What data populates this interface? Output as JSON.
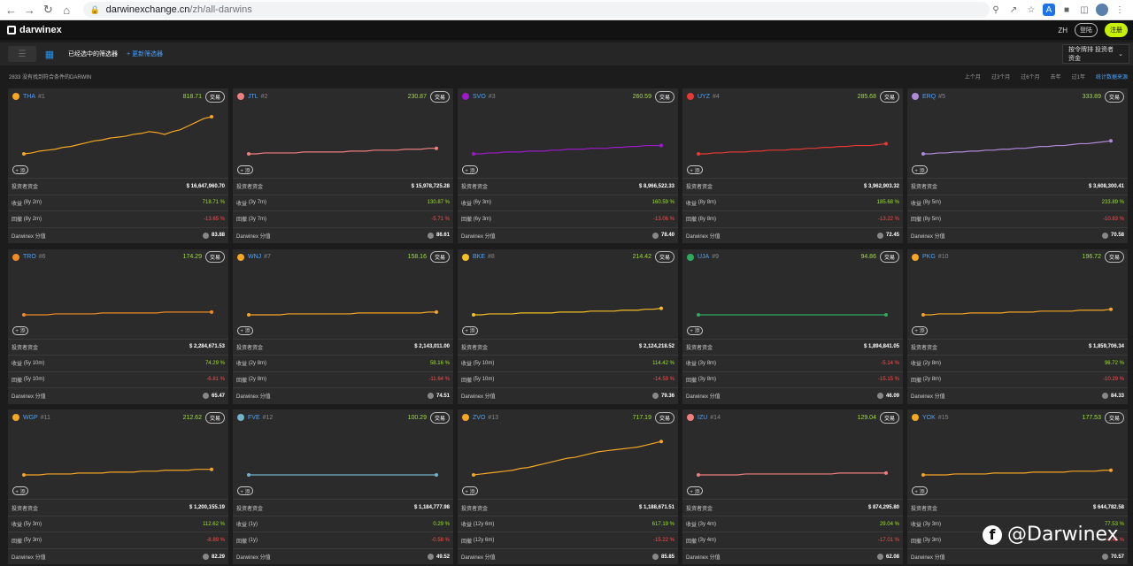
{
  "browser": {
    "url_host": "darwinexchange.cn",
    "url_path": "/zh/all-darwins",
    "icons": [
      "back-icon",
      "forward-icon",
      "reload-icon",
      "home-icon",
      "lock-icon",
      "zoom-icon",
      "share-icon",
      "star-icon",
      "translate-icon",
      "extensions-icon",
      "sidebar-icon",
      "profile-icon",
      "menu-icon"
    ]
  },
  "topbar": {
    "logo_text": "darwinex",
    "lang": "ZH",
    "login_label": "登陆",
    "register_label": "注册"
  },
  "toolbar": {
    "title": "已经选中的筛选器",
    "add_filter": "+ 更新筛选器",
    "sort_label": "按令牌排 投资者资金"
  },
  "subbar": {
    "results": "2833 没有找到符合条件的DARWIN",
    "periods": [
      "上个月",
      "过3个月",
      "过6个月",
      "去年",
      "过1年",
      "统计数据来源"
    ],
    "active_index": 5
  },
  "labels": {
    "investor_funds": "投资者资金",
    "return": "收益",
    "drawdown": "回撤",
    "score": "Darwinex 分值",
    "trade": "交易",
    "add": "+ 添"
  },
  "cards": [
    {
      "ticker": "THA",
      "rank": "#1",
      "price": "818.71",
      "color": "#f5a623",
      "funds": "$ 16,647,960.70",
      "ret_period": "(8y 2m)",
      "ret": "718.71 %",
      "dd_period": "(8y 2m)",
      "dd": "-13.65 %",
      "score": "83.88",
      "curve": [
        10,
        11,
        13,
        14,
        15,
        17,
        18,
        20,
        22,
        24,
        25,
        27,
        28,
        29,
        31,
        32,
        34,
        33,
        31,
        34,
        36,
        40,
        44,
        48,
        50
      ]
    },
    {
      "ticker": "JTL",
      "rank": "#2",
      "price": "230.87",
      "color": "#ef7f7f",
      "funds": "$ 15,978,725.28",
      "ret_period": "(3y 7m)",
      "ret": "130.87 %",
      "dd_period": "(3y 7m)",
      "dd": "-5.71 %",
      "score": "86.61",
      "curve": [
        10,
        10,
        11,
        11,
        11,
        11,
        11,
        12,
        12,
        12,
        12,
        12,
        12,
        13,
        13,
        13,
        14,
        14,
        14,
        14,
        15,
        15,
        15,
        16,
        16
      ]
    },
    {
      "ticker": "SVO",
      "rank": "#3",
      "price": "260.59",
      "color": "#9b1ac9",
      "funds": "$ 8,966,522.33",
      "ret_period": "(6y 3m)",
      "ret": "160.59 %",
      "dd_period": "(6y 3m)",
      "dd": "-13.06 %",
      "score": "78.40",
      "curve": [
        10,
        10,
        11,
        11,
        12,
        12,
        12,
        13,
        13,
        13,
        14,
        14,
        15,
        15,
        15,
        16,
        16,
        16,
        17,
        17,
        18,
        18,
        19,
        19,
        19
      ]
    },
    {
      "ticker": "UYZ",
      "rank": "#4",
      "price": "285.68",
      "color": "#e53935",
      "funds": "$ 3,962,903.32",
      "ret_period": "(8y 8m)",
      "ret": "185.68 %",
      "dd_period": "(8y 8m)",
      "dd": "-13.22 %",
      "score": "72.45",
      "curve": [
        10,
        10,
        11,
        11,
        12,
        12,
        12,
        13,
        13,
        14,
        14,
        14,
        15,
        15,
        16,
        16,
        17,
        17,
        18,
        18,
        19,
        19,
        19,
        20,
        21
      ]
    },
    {
      "ticker": "ERQ",
      "rank": "#5",
      "price": "333.89",
      "color": "#b089d8",
      "funds": "$ 3,608,300.41",
      "ret_period": "(8y 5m)",
      "ret": "233.89 %",
      "dd_period": "(8y 5m)",
      "dd": "-10.83 %",
      "score": "70.58",
      "curve": [
        10,
        10,
        11,
        11,
        12,
        12,
        13,
        13,
        14,
        14,
        15,
        15,
        16,
        16,
        17,
        18,
        18,
        19,
        19,
        20,
        21,
        21,
        22,
        23,
        24
      ]
    },
    {
      "ticker": "TRO",
      "rank": "#6",
      "price": "174.29",
      "color": "#f08a24",
      "funds": "$ 2,284,671.53",
      "ret_period": "(5y 10m)",
      "ret": "74.29 %",
      "dd_period": "(5y 10m)",
      "dd": "-6.81 %",
      "score": "65.47",
      "curve": [
        10,
        10,
        10,
        10,
        11,
        11,
        11,
        11,
        11,
        11,
        12,
        12,
        12,
        12,
        12,
        12,
        12,
        12,
        13,
        13,
        13,
        13,
        13,
        13,
        13
      ]
    },
    {
      "ticker": "WNJ",
      "rank": "#7",
      "price": "158.16",
      "color": "#f5a623",
      "funds": "$ 2,143,011.00",
      "ret_period": "(2y 8m)",
      "ret": "58.16 %",
      "dd_period": "(2y 8m)",
      "dd": "-11.64 %",
      "score": "74.51",
      "curve": [
        10,
        10,
        10,
        10,
        10,
        11,
        11,
        11,
        11,
        11,
        11,
        11,
        11,
        11,
        12,
        12,
        12,
        12,
        12,
        12,
        12,
        12,
        12,
        13,
        13
      ]
    },
    {
      "ticker": "BKE",
      "rank": "#8",
      "price": "214.42",
      "color": "#f5c023",
      "funds": "$ 2,124,218.52",
      "ret_period": "(5y 10m)",
      "ret": "114.42 %",
      "dd_period": "(5y 10m)",
      "dd": "-14.59 %",
      "score": "79.36",
      "curve": [
        10,
        10,
        11,
        11,
        11,
        11,
        12,
        12,
        12,
        12,
        12,
        13,
        13,
        13,
        13,
        14,
        14,
        14,
        14,
        15,
        15,
        15,
        16,
        16,
        17
      ]
    },
    {
      "ticker": "UJA",
      "rank": "#9",
      "price": "94.86",
      "color": "#2eaa5c",
      "funds": "$ 1,894,841.05",
      "ret_period": "(3y 8m)",
      "ret": "-5.14 %",
      "dd_period": "(3y 8m)",
      "dd": "-15.15 %",
      "score": "46.09",
      "curve": [
        10,
        10,
        10,
        10,
        10,
        10,
        10,
        10,
        10,
        10,
        10,
        10,
        10,
        10,
        10,
        10,
        10,
        10,
        10,
        10,
        10,
        10,
        10,
        10,
        10
      ]
    },
    {
      "ticker": "PKG",
      "rank": "#10",
      "price": "196.72",
      "color": "#f5a623",
      "funds": "$ 1,859,706.34",
      "ret_period": "(2y 8m)",
      "ret": "96.72 %",
      "dd_period": "(2y 8m)",
      "dd": "-10.29 %",
      "score": "84.33",
      "curve": [
        10,
        10,
        11,
        11,
        11,
        11,
        12,
        12,
        12,
        12,
        12,
        13,
        13,
        13,
        13,
        14,
        14,
        14,
        14,
        14,
        15,
        15,
        15,
        15,
        16
      ]
    },
    {
      "ticker": "WGP",
      "rank": "#11",
      "price": "212.62",
      "color": "#f5a623",
      "funds": "$ 1,200,155.19",
      "ret_period": "(5y 3m)",
      "ret": "112.62 %",
      "dd_period": "(5y 3m)",
      "dd": "-8.89 %",
      "score": "82.29",
      "curve": [
        10,
        10,
        10,
        11,
        11,
        11,
        11,
        12,
        12,
        12,
        12,
        13,
        13,
        13,
        13,
        14,
        14,
        14,
        15,
        15,
        15,
        15,
        16,
        16,
        16
      ]
    },
    {
      "ticker": "FVE",
      "rank": "#12",
      "price": "100.29",
      "color": "#6fb3c8",
      "funds": "$ 1,184,777.98",
      "ret_period": "(1y)",
      "ret": "0.29 %",
      "dd_period": "(1y)",
      "dd": "-0.58 %",
      "score": "49.52",
      "curve": [
        10,
        10,
        10,
        10,
        10,
        10,
        10,
        10,
        10,
        10,
        10,
        10,
        10,
        10,
        10,
        10,
        10,
        10,
        10,
        10,
        10,
        10,
        10,
        10,
        10
      ]
    },
    {
      "ticker": "ZVO",
      "rank": "#13",
      "price": "717.19",
      "color": "#f5a623",
      "funds": "$ 1,188,671.51",
      "ret_period": "(12y 6m)",
      "ret": "617.19 %",
      "dd_period": "(12y 6m)",
      "dd": "-15.22 %",
      "score": "85.85",
      "curve": [
        10,
        11,
        12,
        13,
        14,
        15,
        17,
        18,
        20,
        22,
        24,
        26,
        28,
        29,
        31,
        33,
        35,
        36,
        37,
        38,
        39,
        40,
        42,
        44,
        46
      ]
    },
    {
      "ticker": "IZU",
      "rank": "#14",
      "price": "129.04",
      "color": "#ef7f7f",
      "funds": "$ 874,295.80",
      "ret_period": "(3y 4m)",
      "ret": "29.04 %",
      "dd_period": "(3y 4m)",
      "dd": "-17.01 %",
      "score": "62.08",
      "curve": [
        10,
        10,
        10,
        10,
        10,
        10,
        11,
        11,
        11,
        11,
        11,
        11,
        11,
        11,
        11,
        11,
        11,
        11,
        12,
        12,
        12,
        12,
        12,
        12,
        12
      ]
    },
    {
      "ticker": "YOK",
      "rank": "#15",
      "price": "177.53",
      "color": "#f5a623",
      "funds": "$ 644,782.58",
      "ret_period": "(3y 3m)",
      "ret": "77.53 %",
      "dd_period": "(3y 3m)",
      "dd": "-9.45 %",
      "score": "70.57",
      "curve": [
        10,
        10,
        10,
        10,
        11,
        11,
        11,
        11,
        11,
        12,
        12,
        12,
        12,
        12,
        13,
        13,
        13,
        13,
        13,
        14,
        14,
        14,
        14,
        15,
        15
      ]
    }
  ],
  "watermark": "@Darwinex"
}
